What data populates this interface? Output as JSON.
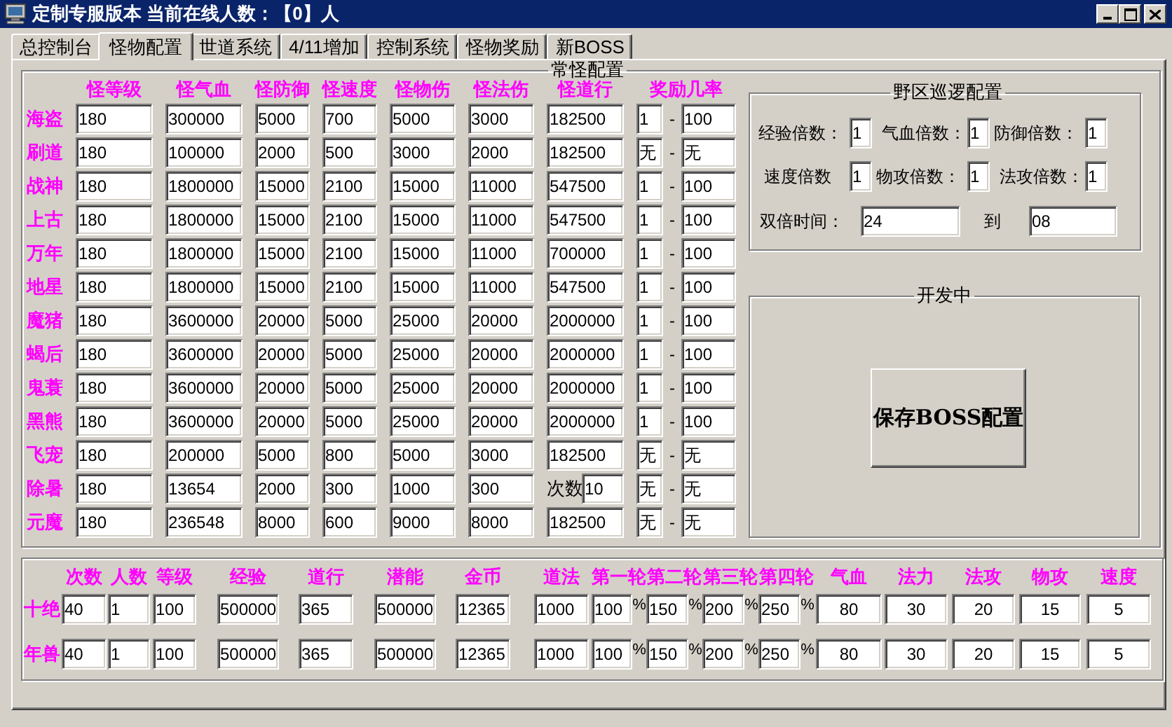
{
  "window": {
    "title": "定制专服版本 当前在线人数：【0】人"
  },
  "tabs": [
    {
      "label": "总控制台",
      "selected": false
    },
    {
      "label": "怪物配置",
      "selected": true
    },
    {
      "label": "世道系统",
      "selected": false
    },
    {
      "label": "4/11增加",
      "selected": false
    },
    {
      "label": "控制系统",
      "selected": false
    },
    {
      "label": "怪物奖励",
      "selected": false
    },
    {
      "label": "新BOSS",
      "selected": false
    }
  ],
  "monster_config": {
    "title": "常怪配置",
    "columns": [
      "怪等级",
      "怪气血",
      "怪防御",
      "怪速度",
      "怪物伤",
      "怪法伤",
      "怪道行",
      "奖励几率"
    ],
    "rows": [
      {
        "name": "海盗",
        "values": [
          "180",
          "300000",
          "5000",
          "700",
          "5000",
          "3000",
          "182500"
        ],
        "reward_min": "1",
        "separator": "-",
        "reward_max": "100"
      },
      {
        "name": "刷道",
        "values": [
          "180",
          "100000",
          "2000",
          "500",
          "3000",
          "2000",
          "182500"
        ],
        "reward_min": "无",
        "separator": "-",
        "reward_max": "无"
      },
      {
        "name": "战神",
        "values": [
          "180",
          "1800000",
          "15000",
          "2100",
          "15000",
          "11000",
          "547500"
        ],
        "reward_min": "1",
        "separator": "-",
        "reward_max": "100"
      },
      {
        "name": "上古",
        "values": [
          "180",
          "1800000",
          "15000",
          "2100",
          "15000",
          "11000",
          "547500"
        ],
        "reward_min": "1",
        "separator": "-",
        "reward_max": "100"
      },
      {
        "name": "万年",
        "values": [
          "180",
          "1800000",
          "15000",
          "2100",
          "15000",
          "11000",
          "700000"
        ],
        "reward_min": "1",
        "separator": "-",
        "reward_max": "100"
      },
      {
        "name": "地星",
        "values": [
          "180",
          "1800000",
          "15000",
          "2100",
          "15000",
          "11000",
          "547500"
        ],
        "reward_min": "1",
        "separator": "-",
        "reward_max": "100"
      },
      {
        "name": "魔猪",
        "values": [
          "180",
          "3600000",
          "20000",
          "5000",
          "25000",
          "20000",
          "2000000"
        ],
        "reward_min": "1",
        "separator": "-",
        "reward_max": "100"
      },
      {
        "name": "蝎后",
        "values": [
          "180",
          "3600000",
          "20000",
          "5000",
          "25000",
          "20000",
          "2000000"
        ],
        "reward_min": "1",
        "separator": "-",
        "reward_max": "100"
      },
      {
        "name": "鬼蓑",
        "values": [
          "180",
          "3600000",
          "20000",
          "5000",
          "25000",
          "20000",
          "2000000"
        ],
        "reward_min": "1",
        "separator": "-",
        "reward_max": "100"
      },
      {
        "name": "黑熊",
        "values": [
          "180",
          "3600000",
          "20000",
          "5000",
          "25000",
          "20000",
          "2000000"
        ],
        "reward_min": "1",
        "separator": "-",
        "reward_max": "100"
      },
      {
        "name": "飞宠",
        "values": [
          "180",
          "200000",
          "5000",
          "800",
          "5000",
          "3000",
          "182500"
        ],
        "reward_min": "无",
        "separator": "-",
        "reward_max": "无"
      },
      {
        "name": "除暑",
        "values": [
          "180",
          "13654",
          "2000",
          "300",
          "1000",
          "300",
          "10"
        ],
        "value_prefix": "次数",
        "reward_min": "无",
        "separator": "-",
        "reward_max": "无"
      },
      {
        "name": "元魔",
        "values": [
          "180",
          "236548",
          "8000",
          "600",
          "9000",
          "8000",
          "182500"
        ],
        "reward_min": "无",
        "separator": "-",
        "reward_max": "无"
      }
    ]
  },
  "patrol": {
    "title": "野区巡逻配置",
    "multipliers": [
      {
        "label": "经验倍数：",
        "value": "1"
      },
      {
        "label": "气血倍数：",
        "value": "1"
      },
      {
        "label": "防御倍数：",
        "value": "1"
      },
      {
        "label": "速度倍数",
        "value": "1"
      },
      {
        "label": "物攻倍数：",
        "value": "1"
      },
      {
        "label": "法攻倍数：",
        "value": "1"
      }
    ],
    "double_time": {
      "label": "双倍时间：",
      "from": "24",
      "to_label": "到",
      "to": "08"
    }
  },
  "dev": {
    "title": "开发中",
    "button": "保存BOSS配置"
  },
  "boss_config": {
    "columns": [
      "次数",
      "人数",
      "等级",
      "经验",
      "道行",
      "潜能",
      "金币",
      "道法",
      "第一轮",
      "第二轮",
      "第三轮",
      "第四轮",
      "气血",
      "法力",
      "法攻",
      "物攻",
      "速度"
    ],
    "rows": [
      {
        "name": "十绝",
        "fields": [
          {
            "value": "40"
          },
          {
            "value": "1"
          },
          {
            "value": "100"
          },
          {
            "value": "500000"
          },
          {
            "value": "365"
          },
          {
            "value": "500000"
          },
          {
            "value": "12365"
          },
          {
            "value": "1000"
          },
          {
            "value": "100",
            "suffix": "%"
          },
          {
            "value": "150",
            "suffix": "%"
          },
          {
            "value": "200",
            "suffix": "%"
          },
          {
            "value": "250",
            "suffix": "%"
          },
          {
            "value": "80"
          },
          {
            "value": "30"
          },
          {
            "value": "20"
          },
          {
            "value": "15"
          },
          {
            "value": "5"
          }
        ]
      },
      {
        "name": "年兽",
        "fields": [
          {
            "value": "40"
          },
          {
            "value": "1"
          },
          {
            "value": "100"
          },
          {
            "value": "500000"
          },
          {
            "value": "365"
          },
          {
            "value": "500000"
          },
          {
            "value": "12365"
          },
          {
            "value": "1000"
          },
          {
            "value": "100",
            "suffix": "%"
          },
          {
            "value": "150",
            "suffix": "%"
          },
          {
            "value": "200",
            "suffix": "%"
          },
          {
            "value": "250",
            "suffix": "%"
          },
          {
            "value": "80"
          },
          {
            "value": "30"
          },
          {
            "value": "20"
          },
          {
            "value": "15"
          },
          {
            "value": "5"
          }
        ]
      }
    ]
  }
}
